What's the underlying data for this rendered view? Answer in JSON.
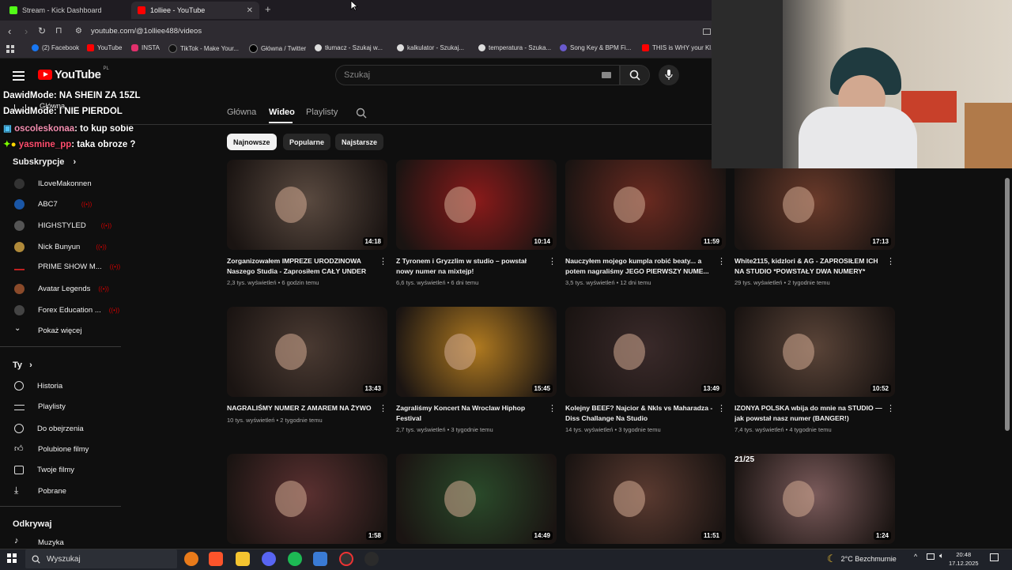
{
  "browser": {
    "tabs": [
      {
        "label": "Stream - Kick Dashboard",
        "color": "#53fc18"
      },
      {
        "label": "1olliee - YouTube",
        "color": "#ff0000"
      }
    ],
    "url": "youtube.com/@1olliee488/videos",
    "bookmarks": [
      {
        "label": "(2) Facebook",
        "color": "#1877f2"
      },
      {
        "label": "YouTube",
        "color": "#ff0000"
      },
      {
        "label": "INSTA",
        "color": "#e1306c"
      },
      {
        "label": "TikTok - Make Your...",
        "color": "#111111"
      },
      {
        "label": "Główna / Twitter",
        "color": "#333333"
      },
      {
        "label": "tłumacz - Szukaj w...",
        "color": "#dddddd"
      },
      {
        "label": "kalkulator - Szukaj...",
        "color": "#dddddd"
      },
      {
        "label": "temperatura - Szuka...",
        "color": "#dddddd"
      },
      {
        "label": "Song Key & BPM Fi...",
        "color": "#6a5acd"
      },
      {
        "label": "THIS is WHY your Kl...",
        "color": "#ff0000"
      }
    ]
  },
  "youtube": {
    "logo_text": "YouTube",
    "region": "PL",
    "search_placeholder": "Szukaj"
  },
  "chat": [
    {
      "user": "DawidMode",
      "text": ": NA SHEIN ZA 15ZL"
    },
    {
      "user": "DawidMode",
      "text": ": I NIE PIERDOL"
    },
    {
      "user": "oscoleskonaa",
      "text": ": to kup sobie"
    },
    {
      "user": "yasmine_pp",
      "text": ": taka obroze ?"
    }
  ],
  "sidebar": {
    "home_label": "Główna",
    "subs_header": "Subskrypcje",
    "subscriptions": [
      {
        "name": "ILoveMakonnen",
        "live": false,
        "color": "#333"
      },
      {
        "name": "ABC7",
        "live": true,
        "color": "#1a56a6"
      },
      {
        "name": "HIGHSTYLED",
        "live": true,
        "color": "#555"
      },
      {
        "name": "Nick Bunyun",
        "live": true,
        "color": "#b08a3a"
      },
      {
        "name": "PRIME SHOW M...",
        "live": true,
        "color": "#c02020"
      },
      {
        "name": "Avatar Legends",
        "live": true,
        "color": "#8a4a2a"
      },
      {
        "name": "Forex Education ...",
        "live": true,
        "color": "#444"
      }
    ],
    "show_more": "Pokaż więcej",
    "you_header": "Ty",
    "you_items": [
      "Historia",
      "Playlisty",
      "Do obejrzenia",
      "Polubione filmy",
      "Twoje filmy",
      "Pobrane"
    ],
    "explore_header": "Odkrywaj",
    "explore_items": [
      "Muzyka"
    ]
  },
  "channel_tabs": [
    "Główna",
    "Wideo",
    "Playlisty"
  ],
  "chips": [
    "Najnowsze",
    "Popularne",
    "Najstarsze"
  ],
  "videos": [
    {
      "title": "Zorganizowałem IMPREZE URODZINOWA Naszego Studia - Zaprosiłem CAŁY UNDER",
      "views": "2,3 tys. wyświetleń",
      "age": "6 godzin temu",
      "duration": "14:18",
      "color": "#5a4a40"
    },
    {
      "title": "Z Tyronem i Gryzzlim w studio – powstał nowy numer na mixtejp!",
      "views": "6,6 tys. wyświetleń",
      "age": "6 dni temu",
      "duration": "10:14",
      "color": "#8a1a1a"
    },
    {
      "title": "Nauczyłem mojego kumpla robić beaty... a potem nagraliśmy JEGO PIERWSZY NUME...",
      "views": "3,5 tys. wyświetleń",
      "age": "12 dni temu",
      "duration": "11:59",
      "color": "#6a2a20"
    },
    {
      "title": "White2115, kidzlori & AG - ZAPROSIŁEM ICH NA STUDIO *POWSTAŁY DWA NUMERY*",
      "views": "29 tys. wyświetleń",
      "age": "2 tygodnie temu",
      "duration": "17:13",
      "color": "#6a3a2a"
    },
    {
      "title": "NAGRALIŚMY NUMER Z AMAREM NA ŻYWO",
      "views": "10 tys. wyświetleń",
      "age": "2 tygodnie temu",
      "duration": "13:43",
      "color": "#4a3a32"
    },
    {
      "title": "Zagraliśmy Koncert Na Wroclaw Hiphop Festival",
      "views": "2,7 tys. wyświetleń",
      "age": "3 tygodnie temu",
      "duration": "15:45",
      "color": "#b07a20"
    },
    {
      "title": "Kolejny BEEF? Najcior & Nkls vs Maharadza - Diss Challange Na Studio",
      "views": "14 tys. wyświetleń",
      "age": "3 tygodnie temu",
      "duration": "13:49",
      "color": "#3a2a2a"
    },
    {
      "title": "IZONYA POLSKA wbija do mnie na STUDIO — jak powstał nasz numer (BANGER!)",
      "views": "7,4 tys. wyświetleń",
      "age": "4 tygodnie temu",
      "duration": "10:52",
      "color": "#5a4438"
    },
    {
      "title": "",
      "views": "",
      "age": "",
      "duration": "1:58",
      "color": "#5a3030"
    },
    {
      "title": "",
      "views": "",
      "age": "",
      "duration": "14:49",
      "color": "#2a4a2a"
    },
    {
      "title": "",
      "views": "",
      "age": "",
      "duration": "11:51",
      "color": "#5a3a30"
    },
    {
      "title": "",
      "views": "",
      "age": "",
      "duration": "1:24",
      "color": "#7a5a5a"
    }
  ],
  "thumb_badge": "21/25",
  "taskbar": {
    "search_label": "Wyszukaj",
    "weather": "2°C  Bezchmurnie",
    "time": "20:48",
    "date": "17.12.2025"
  }
}
